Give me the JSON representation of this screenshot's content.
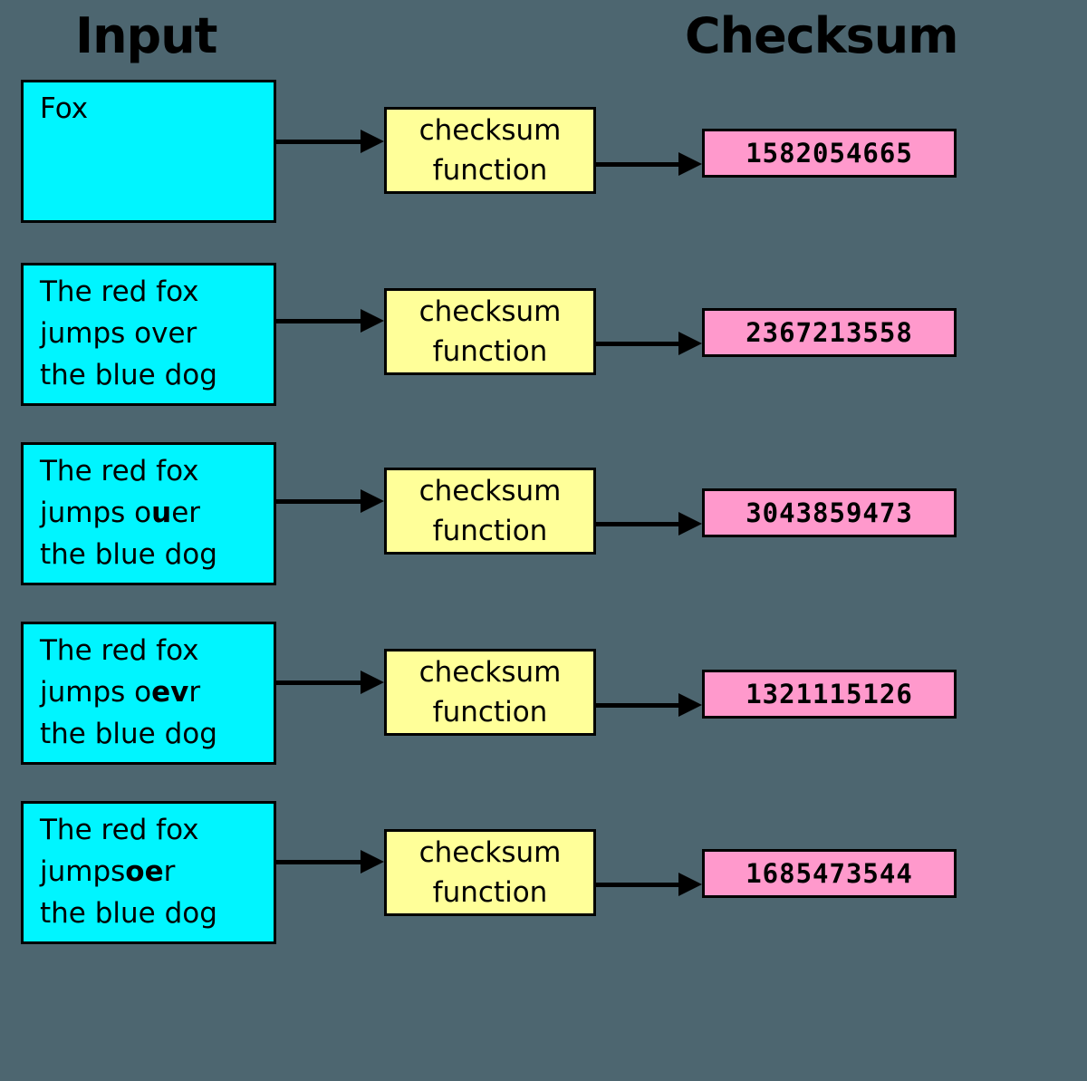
{
  "headings": {
    "input": "Input",
    "checksum": "Checksum"
  },
  "colors": {
    "background": "#4d6670",
    "input_box": "#00f5ff",
    "function_box": "#ffff99",
    "checksum_box": "#ff99cc",
    "stroke": "#000000"
  },
  "function_label": {
    "line1": "checksum",
    "line2": "function"
  },
  "rows": [
    {
      "input_text": "Fox",
      "input_segments": [
        {
          "text": "Fox",
          "bold": false
        }
      ],
      "checksum": "1582054665"
    },
    {
      "input_text": "The red fox jumps over the blue dog",
      "input_segments": [
        {
          "text": "The red fox\njumps over\nthe blue dog",
          "bold": false
        }
      ],
      "checksum": "2367213558"
    },
    {
      "input_text": "The red fox jumps ouer the blue dog",
      "input_segments": [
        {
          "text": "The red fox\njumps o",
          "bold": false
        },
        {
          "text": "u",
          "bold": true
        },
        {
          "text": "er\nthe blue dog",
          "bold": false
        }
      ],
      "checksum": "3043859473"
    },
    {
      "input_text": "The red fox jumps oevr the blue dog",
      "input_segments": [
        {
          "text": "The red fox\njumps o",
          "bold": false
        },
        {
          "text": "ev",
          "bold": true
        },
        {
          "text": "r\nthe blue dog",
          "bold": false
        }
      ],
      "checksum": "1321115126"
    },
    {
      "input_text": "The red fox jumpsoer the blue dog",
      "input_segments": [
        {
          "text": "The red fox\njumps",
          "bold": false
        },
        {
          "text": "oe",
          "bold": true
        },
        {
          "text": "r\nthe blue dog",
          "bold": false
        }
      ],
      "checksum": "1685473544"
    }
  ]
}
